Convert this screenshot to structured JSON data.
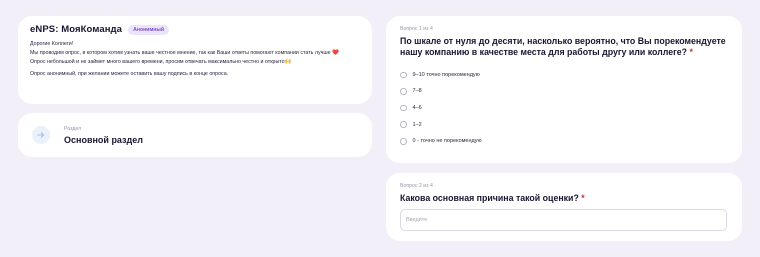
{
  "intro": {
    "title": "eNPS: МояКоманда",
    "badge": "Анонимный",
    "greeting": "Дорогие Коллеги!",
    "paragraph1": "Мы проводим опрос, в котором хотим узнать ваше честное мнение, так как Ваши ответы помогают компании стать лучше",
    "paragraph2": "Опрос небольшой и не займет много вашего времени, просим отвечать максимально честно и открыто",
    "paragraph3": "Опрос анонимный, при желании можете оставить вашу подпись в конце опроса.",
    "heart_emoji": "❤️",
    "hands_emoji": "🙌"
  },
  "section": {
    "label": "Раздел",
    "name": "Основной раздел",
    "icon": "arrow-right-icon"
  },
  "question1": {
    "counter": "Вопрос 1 из 4",
    "title": "По шкале от нуля до десяти, насколько вероятно, что Вы порекомендуете нашу компанию в качестве места для работы другу или коллеге?",
    "required_mark": "*",
    "options": [
      "9–10 точно порекомендую",
      "7–8",
      "4–6",
      "1–2",
      "0 - точно не порекомендую"
    ]
  },
  "question2": {
    "counter": "Вопрос 2 из 4",
    "title": "Какова основная причина такой оценки?",
    "required_mark": "*",
    "input_value": "",
    "input_placeholder": "Введите"
  },
  "colors": {
    "background": "#f3eff8",
    "card": "#ffffff",
    "badge_bg": "#ece4fb",
    "badge_text": "#7b4fd6",
    "required": "#e0283a",
    "section_icon": "#9cbfe8"
  }
}
